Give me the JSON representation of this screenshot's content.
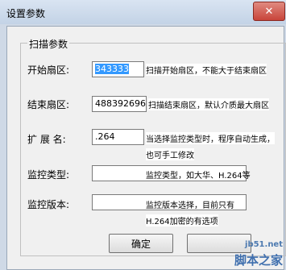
{
  "window": {
    "title": "设置参数",
    "close_glyph": "✕"
  },
  "group": {
    "title": "扫描参数"
  },
  "fields": [
    {
      "label": "开始扇区:",
      "value": "343333",
      "hint": "扫描开始扇区，不能大于结束扇区"
    },
    {
      "label": "结束扇区:",
      "value": "488392696",
      "hint": "扫描结束扇区，默认介质最大扇区"
    },
    {
      "label": "扩  展  名:",
      "value": ".264",
      "hint": "当选择监控类型时，程序自动生成，",
      "hint2": "也可手工修改"
    },
    {
      "label": "监控类型:",
      "value": "",
      "hint": "监控类型，如大华、H.264等"
    },
    {
      "label": "监控版本:",
      "value": "",
      "hint": "监控版本选择，目前只有",
      "hint2": "H.264加密的有选项"
    }
  ],
  "buttons": {
    "ok": "确定",
    "cancel": ""
  },
  "watermark": {
    "url": "jb51.net",
    "logo": "脚本之家"
  }
}
